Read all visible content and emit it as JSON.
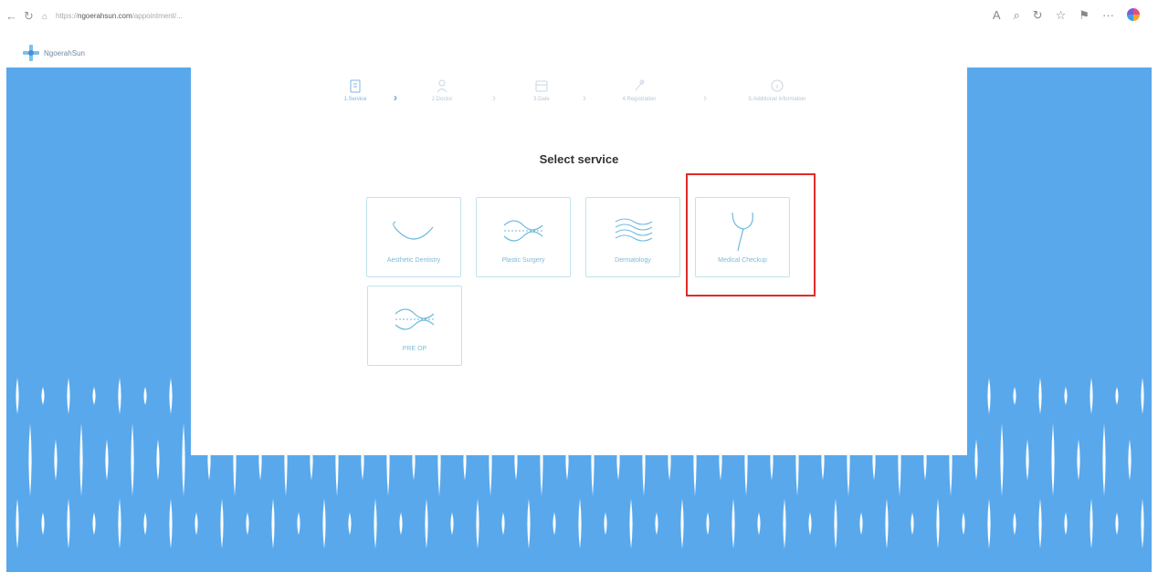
{
  "browser": {
    "url_prefix": "https://",
    "url_domain": "ngoerahsun.com",
    "url_path": "/appointment/...",
    "back_icon": "arrow-left-icon",
    "reload_icon": "refresh-icon"
  },
  "site": {
    "logo_text": "NgoerahSun"
  },
  "stepper": {
    "steps": [
      {
        "label": "1.Service",
        "icon": "clipboard-icon",
        "active": true
      },
      {
        "label": "2.Doctor",
        "icon": "doctor-icon",
        "active": false
      },
      {
        "label": "3.Date",
        "icon": "calendar-icon",
        "active": false
      },
      {
        "label": "4.Registration",
        "icon": "registration-icon",
        "active": false
      },
      {
        "label": "5.Additional Information",
        "icon": "info-icon",
        "active": false
      }
    ]
  },
  "main": {
    "title": "Select service",
    "services": [
      {
        "label": "Aesthetic Dentistry",
        "icon": "smile-curve-icon"
      },
      {
        "label": "Plastic Surgery",
        "icon": "wave-dotted-icon"
      },
      {
        "label": "Dermatology",
        "icon": "waves-icon"
      },
      {
        "label": "Medical Checkup",
        "icon": "stethoscope-icon",
        "highlighted": true
      },
      {
        "label": "PRE OP",
        "icon": "wave-dotted-icon"
      }
    ]
  },
  "colors": {
    "background_blue": "#59a8ec",
    "tile_border": "#bfe4ec",
    "tile_label": "#7fb9d8",
    "highlight_red": "#e02b2b"
  }
}
